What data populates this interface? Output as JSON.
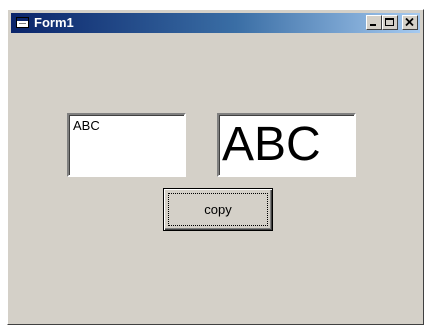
{
  "window": {
    "title": "Form1",
    "controls": [
      "minimize",
      "maximize",
      "close"
    ]
  },
  "text_box": {
    "value": "ABC"
  },
  "label_display": {
    "value": "ABC"
  },
  "copy_button": {
    "label": "copy"
  },
  "colors": {
    "face": "#d4d0c8",
    "titlebar_start": "#0a246a",
    "titlebar_end": "#a6caf0"
  }
}
